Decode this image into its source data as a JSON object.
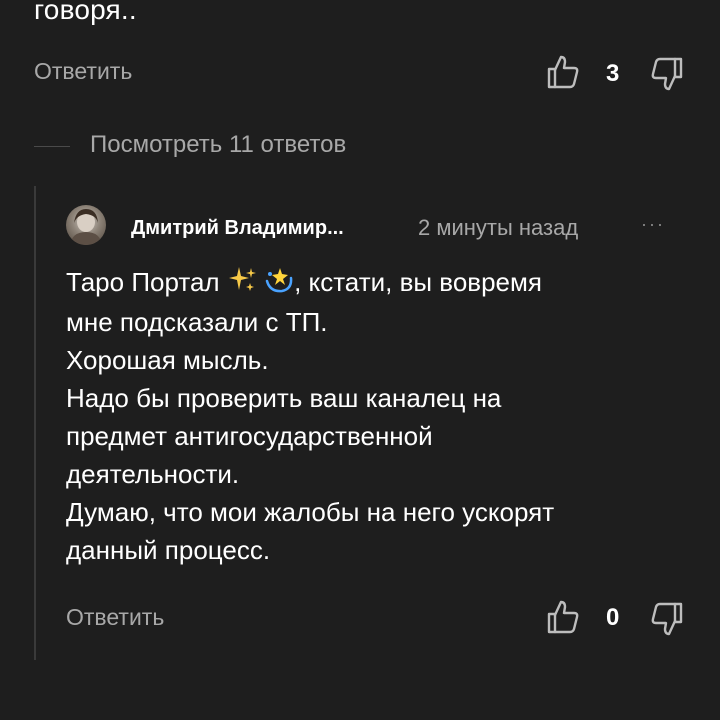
{
  "parent_comment": {
    "text_tail": "говоря..",
    "reply_label": "Ответить",
    "likes": "3",
    "icons": {
      "like": "thumbs-up-icon",
      "dislike": "thumbs-down-icon"
    }
  },
  "replies_toggle": {
    "label": "Посмотреть 11 ответов"
  },
  "reply_comment": {
    "author": "Дмитрий Владимир...",
    "time": "2 минуты назад",
    "more_icon": "ellipsis-icon",
    "lines": [
      {
        "before": "Таро   Портал",
        "emoji": [
          "sparkles-icon",
          "dizzy-star-icon"
        ],
        "after": ", кстати, вы вовремя"
      },
      "мне подсказали с ТП.",
      "Хорошая мысль.",
      "Надо бы проверить ваш каналец на",
      "предмет антигосударственной",
      "деятельности.",
      "Думаю, что мои жалобы на него ускорят",
      "данный процесс."
    ],
    "reply_label": "Ответить",
    "likes": "0"
  },
  "colors": {
    "background": "#1e1e1e",
    "text": "#ffffff",
    "muted": "#a8a8a8",
    "divider": "#4a4a4a"
  }
}
